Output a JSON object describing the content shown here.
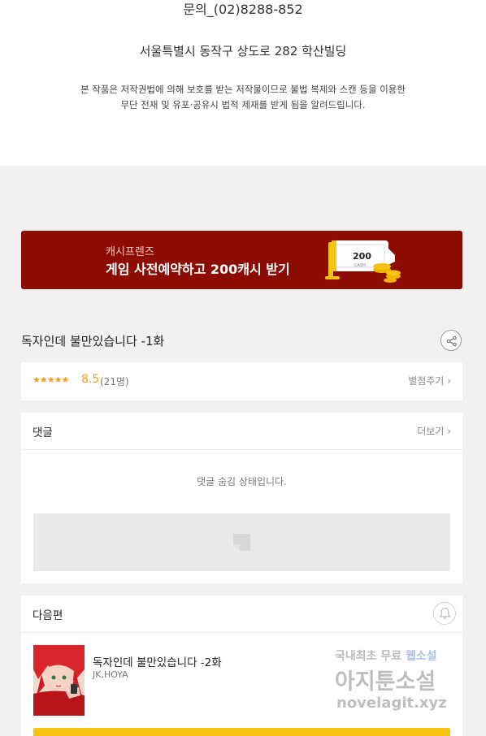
{
  "footer_info": {
    "contact": "문의_(02)8288-852",
    "address": "서울특별시 동작구 상도로 282 학산빌딩",
    "copyright_line1": "본 작품은 저작권법에 의해 보호를 받는 저작물이므로 불법 복제와 스캔 등을 이용한",
    "copyright_line2": "무단 전재 및 유포·공유시 법적 제재를 받게 됨을 알려드립니다."
  },
  "banner": {
    "subtitle": "캐시프렌즈",
    "title": "게임 사전예약하고 200캐시 받기",
    "coupon_value": "200",
    "coupon_unit": "CASH",
    "background": "#8c0b03"
  },
  "episode": {
    "title": "독자인데 불만있습니다  -1화",
    "share_icon": "share-icon"
  },
  "rating": {
    "stars": "★★★★★",
    "score": "8.5",
    "count": "(21명)",
    "rate_link": "별점주기",
    "accent": "#f19b1d"
  },
  "comments": {
    "label": "댓글",
    "more": "더보기",
    "hidden_message": "댓글 숨김 상태입니다."
  },
  "next_episode": {
    "label": "다음편",
    "title": "독자인데 불만있습니다  -2화",
    "author": "JK,HOYA",
    "bell_icon": "bell-icon",
    "accent": "#f6c314"
  },
  "watermark": {
    "line1_a": "국내최초 무료 ",
    "line1_b": "웹소설",
    "line2": "아지툰소설",
    "line3": "novelagit.xyz"
  }
}
